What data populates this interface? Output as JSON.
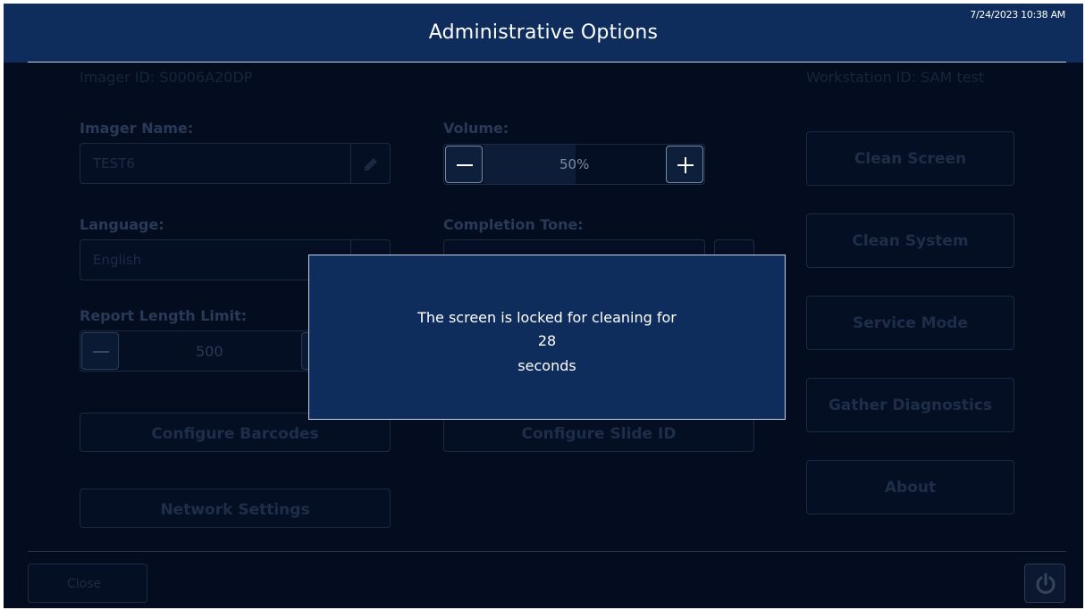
{
  "header": {
    "title": "Administrative Options",
    "datetime": "7/24/2023 10:38 AM"
  },
  "info": {
    "imager_id": "Imager ID: S0006A20DP",
    "workstation_id": "Workstation ID: SAM test"
  },
  "settings": {
    "imager_name": {
      "label": "Imager Name:",
      "value": "TEST6",
      "icon": "pencil-icon"
    },
    "language": {
      "label": "Language:",
      "value": "English",
      "icon": "chevron-down-icon"
    },
    "report_length": {
      "label": "Report Length Limit:",
      "value": "500"
    },
    "volume": {
      "label": "Volume:",
      "value": "50%",
      "level": 0.5
    },
    "completion_tone": {
      "label": "Completion Tone:",
      "icon": "speaker-icon"
    }
  },
  "buttons": {
    "configure_barcodes": "Configure Barcodes",
    "configure_slide_id": "Configure Slide ID",
    "network_settings": "Network Settings",
    "clean_screen": "Clean Screen",
    "clean_system": "Clean System",
    "service_mode": "Service Mode",
    "gather_diagnostics": "Gather Diagnostics",
    "about": "About"
  },
  "modal": {
    "line1": "The screen is locked for cleaning for",
    "seconds": "28",
    "line3": "seconds"
  },
  "footer": {
    "close_label": "Close",
    "power_icon": "power-icon"
  },
  "colors": {
    "title_bar": "#0f2d5c",
    "background": "#040d1f",
    "modal": "#0f2d5c",
    "modal_border": "#c8d2e4",
    "text_bright": "#ffffff"
  }
}
